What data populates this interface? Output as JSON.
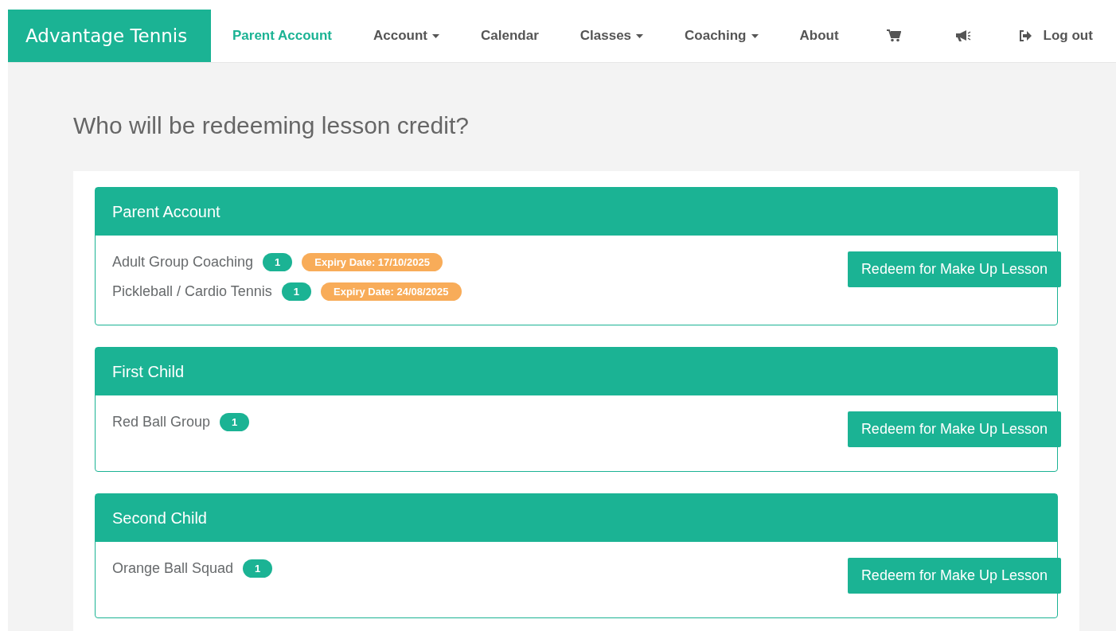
{
  "brand": "Advantage Tennis",
  "nav": [
    {
      "kind": "link",
      "label": "Parent Account",
      "selected": true
    },
    {
      "kind": "dropdown",
      "label": "Account",
      "selected": false
    },
    {
      "kind": "link",
      "label": "Calendar",
      "selected": false
    },
    {
      "kind": "dropdown",
      "label": "Classes",
      "selected": false
    },
    {
      "kind": "dropdown",
      "label": "Coaching",
      "selected": false
    },
    {
      "kind": "link",
      "label": "About",
      "selected": false
    },
    {
      "kind": "cart",
      "selected": false
    },
    {
      "kind": "megaphone",
      "selected": false
    },
    {
      "kind": "logout",
      "label": "Log out",
      "selected": false
    }
  ],
  "heading": "Who will be redeeming lesson credit?",
  "cards": [
    {
      "title": "Parent Account",
      "button": "Redeem for Make Up Lesson",
      "items": [
        {
          "name": "Adult Group Coaching",
          "count": "1",
          "expiry": "Expiry Date: 17/10/2025"
        },
        {
          "name": "Pickleball / Cardio Tennis",
          "count": "1",
          "expiry": "Expiry Date: 24/08/2025"
        }
      ]
    },
    {
      "title": "First Child",
      "button": "Redeem for Make Up Lesson",
      "items": [
        {
          "name": "Red Ball Group",
          "count": "1"
        }
      ]
    },
    {
      "title": "Second Child",
      "button": "Redeem for Make Up Lesson",
      "items": [
        {
          "name": "Orange Ball Squad",
          "count": "1"
        }
      ]
    }
  ]
}
